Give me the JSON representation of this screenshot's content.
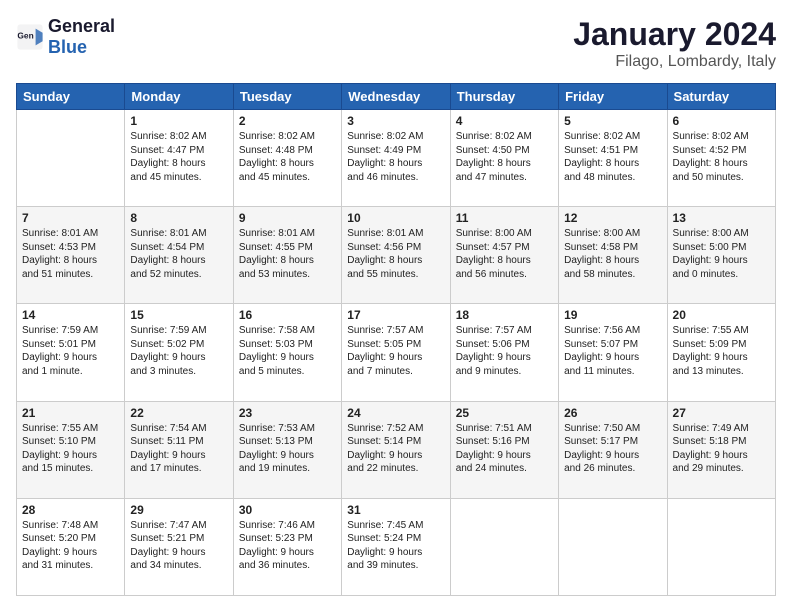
{
  "logo": {
    "text_general": "General",
    "text_blue": "Blue"
  },
  "header": {
    "title": "January 2024",
    "subtitle": "Filago, Lombardy, Italy"
  },
  "weekdays": [
    "Sunday",
    "Monday",
    "Tuesday",
    "Wednesday",
    "Thursday",
    "Friday",
    "Saturday"
  ],
  "weeks": [
    [
      {
        "day": "",
        "info": ""
      },
      {
        "day": "1",
        "info": "Sunrise: 8:02 AM\nSunset: 4:47 PM\nDaylight: 8 hours\nand 45 minutes."
      },
      {
        "day": "2",
        "info": "Sunrise: 8:02 AM\nSunset: 4:48 PM\nDaylight: 8 hours\nand 45 minutes."
      },
      {
        "day": "3",
        "info": "Sunrise: 8:02 AM\nSunset: 4:49 PM\nDaylight: 8 hours\nand 46 minutes."
      },
      {
        "day": "4",
        "info": "Sunrise: 8:02 AM\nSunset: 4:50 PM\nDaylight: 8 hours\nand 47 minutes."
      },
      {
        "day": "5",
        "info": "Sunrise: 8:02 AM\nSunset: 4:51 PM\nDaylight: 8 hours\nand 48 minutes."
      },
      {
        "day": "6",
        "info": "Sunrise: 8:02 AM\nSunset: 4:52 PM\nDaylight: 8 hours\nand 50 minutes."
      }
    ],
    [
      {
        "day": "7",
        "info": "Sunrise: 8:01 AM\nSunset: 4:53 PM\nDaylight: 8 hours\nand 51 minutes."
      },
      {
        "day": "8",
        "info": "Sunrise: 8:01 AM\nSunset: 4:54 PM\nDaylight: 8 hours\nand 52 minutes."
      },
      {
        "day": "9",
        "info": "Sunrise: 8:01 AM\nSunset: 4:55 PM\nDaylight: 8 hours\nand 53 minutes."
      },
      {
        "day": "10",
        "info": "Sunrise: 8:01 AM\nSunset: 4:56 PM\nDaylight: 8 hours\nand 55 minutes."
      },
      {
        "day": "11",
        "info": "Sunrise: 8:00 AM\nSunset: 4:57 PM\nDaylight: 8 hours\nand 56 minutes."
      },
      {
        "day": "12",
        "info": "Sunrise: 8:00 AM\nSunset: 4:58 PM\nDaylight: 8 hours\nand 58 minutes."
      },
      {
        "day": "13",
        "info": "Sunrise: 8:00 AM\nSunset: 5:00 PM\nDaylight: 9 hours\nand 0 minutes."
      }
    ],
    [
      {
        "day": "14",
        "info": "Sunrise: 7:59 AM\nSunset: 5:01 PM\nDaylight: 9 hours\nand 1 minute."
      },
      {
        "day": "15",
        "info": "Sunrise: 7:59 AM\nSunset: 5:02 PM\nDaylight: 9 hours\nand 3 minutes."
      },
      {
        "day": "16",
        "info": "Sunrise: 7:58 AM\nSunset: 5:03 PM\nDaylight: 9 hours\nand 5 minutes."
      },
      {
        "day": "17",
        "info": "Sunrise: 7:57 AM\nSunset: 5:05 PM\nDaylight: 9 hours\nand 7 minutes."
      },
      {
        "day": "18",
        "info": "Sunrise: 7:57 AM\nSunset: 5:06 PM\nDaylight: 9 hours\nand 9 minutes."
      },
      {
        "day": "19",
        "info": "Sunrise: 7:56 AM\nSunset: 5:07 PM\nDaylight: 9 hours\nand 11 minutes."
      },
      {
        "day": "20",
        "info": "Sunrise: 7:55 AM\nSunset: 5:09 PM\nDaylight: 9 hours\nand 13 minutes."
      }
    ],
    [
      {
        "day": "21",
        "info": "Sunrise: 7:55 AM\nSunset: 5:10 PM\nDaylight: 9 hours\nand 15 minutes."
      },
      {
        "day": "22",
        "info": "Sunrise: 7:54 AM\nSunset: 5:11 PM\nDaylight: 9 hours\nand 17 minutes."
      },
      {
        "day": "23",
        "info": "Sunrise: 7:53 AM\nSunset: 5:13 PM\nDaylight: 9 hours\nand 19 minutes."
      },
      {
        "day": "24",
        "info": "Sunrise: 7:52 AM\nSunset: 5:14 PM\nDaylight: 9 hours\nand 22 minutes."
      },
      {
        "day": "25",
        "info": "Sunrise: 7:51 AM\nSunset: 5:16 PM\nDaylight: 9 hours\nand 24 minutes."
      },
      {
        "day": "26",
        "info": "Sunrise: 7:50 AM\nSunset: 5:17 PM\nDaylight: 9 hours\nand 26 minutes."
      },
      {
        "day": "27",
        "info": "Sunrise: 7:49 AM\nSunset: 5:18 PM\nDaylight: 9 hours\nand 29 minutes."
      }
    ],
    [
      {
        "day": "28",
        "info": "Sunrise: 7:48 AM\nSunset: 5:20 PM\nDaylight: 9 hours\nand 31 minutes."
      },
      {
        "day": "29",
        "info": "Sunrise: 7:47 AM\nSunset: 5:21 PM\nDaylight: 9 hours\nand 34 minutes."
      },
      {
        "day": "30",
        "info": "Sunrise: 7:46 AM\nSunset: 5:23 PM\nDaylight: 9 hours\nand 36 minutes."
      },
      {
        "day": "31",
        "info": "Sunrise: 7:45 AM\nSunset: 5:24 PM\nDaylight: 9 hours\nand 39 minutes."
      },
      {
        "day": "",
        "info": ""
      },
      {
        "day": "",
        "info": ""
      },
      {
        "day": "",
        "info": ""
      }
    ]
  ]
}
